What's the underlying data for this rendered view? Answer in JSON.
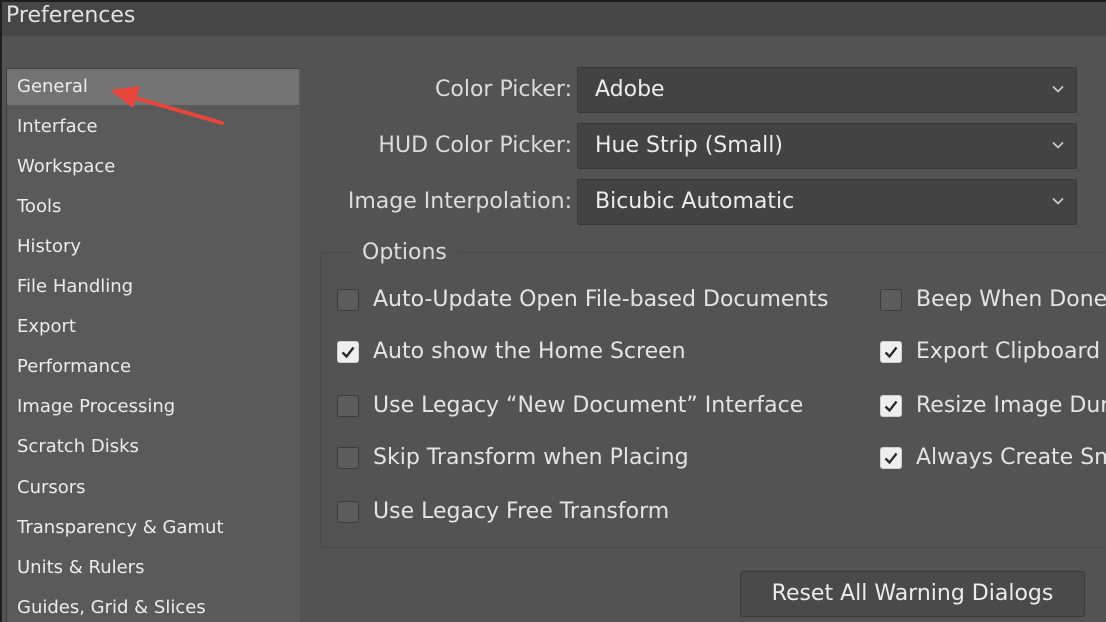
{
  "window": {
    "title": "Preferences"
  },
  "sidebar": {
    "items": [
      {
        "label": "General",
        "selected": true
      },
      {
        "label": "Interface",
        "selected": false
      },
      {
        "label": "Workspace",
        "selected": false
      },
      {
        "label": "Tools",
        "selected": false
      },
      {
        "label": "History",
        "selected": false
      },
      {
        "label": "File Handling",
        "selected": false
      },
      {
        "label": "Export",
        "selected": false
      },
      {
        "label": "Performance",
        "selected": false
      },
      {
        "label": "Image Processing",
        "selected": false
      },
      {
        "label": "Scratch Disks",
        "selected": false
      },
      {
        "label": "Cursors",
        "selected": false
      },
      {
        "label": "Transparency & Gamut",
        "selected": false
      },
      {
        "label": "Units & Rulers",
        "selected": false
      },
      {
        "label": "Guides, Grid & Slices",
        "selected": false
      }
    ]
  },
  "fields": {
    "color_picker": {
      "label": "Color Picker:",
      "value": "Adobe"
    },
    "hud_color_picker": {
      "label": "HUD Color Picker:",
      "value": "Hue Strip (Small)"
    },
    "image_interpolation": {
      "label": "Image Interpolation:",
      "value": "Bicubic Automatic"
    }
  },
  "options": {
    "title": "Options",
    "left": [
      {
        "label": "Auto-Update Open File-based Documents",
        "checked": false
      },
      {
        "label": "Auto show the Home Screen",
        "checked": true
      },
      {
        "label": "Use Legacy “New Document” Interface",
        "checked": false
      },
      {
        "label": "Skip Transform when Placing",
        "checked": false
      },
      {
        "label": "Use Legacy Free Transform",
        "checked": false
      }
    ],
    "right": [
      {
        "label": "Beep When Done",
        "checked": false
      },
      {
        "label": "Export Clipboard",
        "checked": true
      },
      {
        "label": "Resize Image During Paste/Place",
        "checked": true
      },
      {
        "label": "Always Create Smart Objects when Placing",
        "checked": true
      }
    ]
  },
  "buttons": {
    "reset_warning_dialogs": "Reset All Warning Dialogs"
  },
  "annotation": {
    "arrow_color": "#e8463a"
  },
  "colors": {
    "panel_bg": "#535353",
    "selected_item": "#737373",
    "dropdown_bg": "#434343"
  }
}
